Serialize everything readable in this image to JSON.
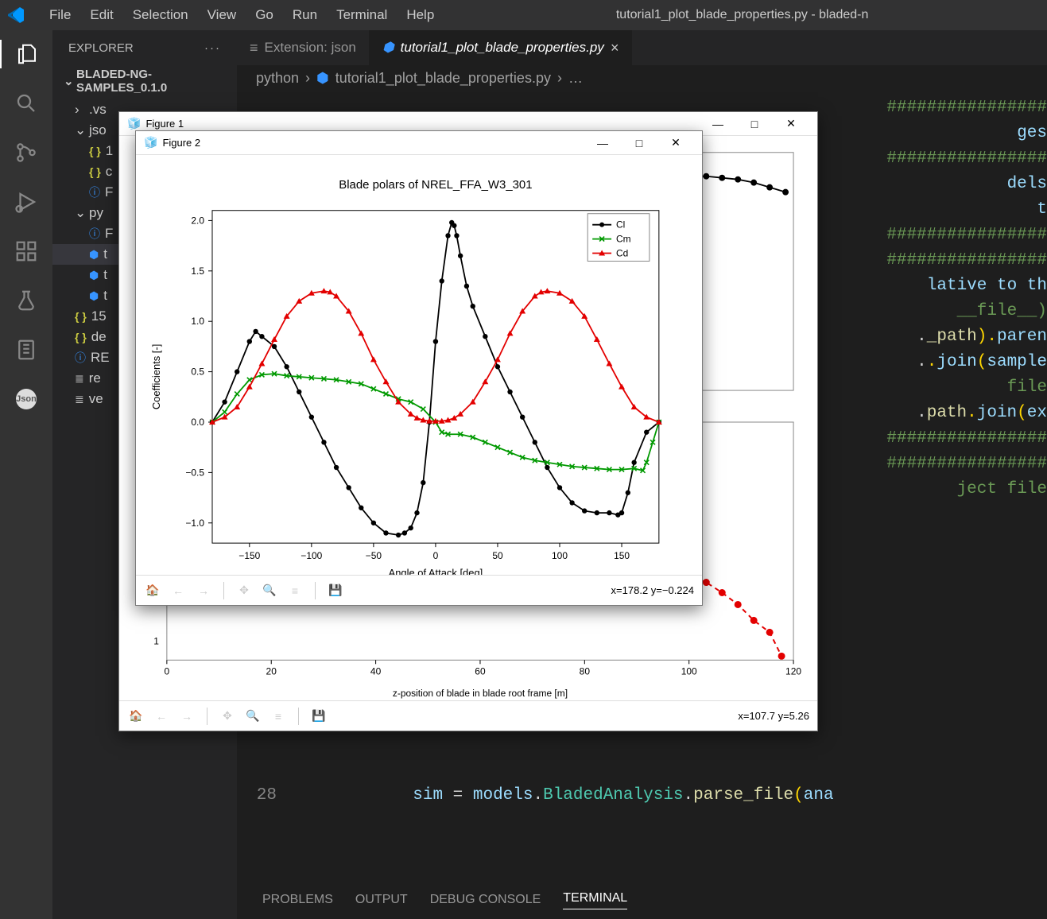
{
  "titlebar": {
    "menus": [
      "File",
      "Edit",
      "Selection",
      "View",
      "Go",
      "Run",
      "Terminal",
      "Help"
    ],
    "title": "tutorial1_plot_blade_properties.py - bladed-n"
  },
  "sidebar": {
    "header": "EXPLORER",
    "workspace": "BLADED-NG-SAMPLES_0.1.0",
    "tree": [
      {
        "label": ".vs",
        "kind": "folder",
        "expanded": false,
        "indent": 1
      },
      {
        "label": "jso",
        "kind": "folder",
        "expanded": true,
        "indent": 1
      },
      {
        "label": "1",
        "kind": "json",
        "indent": 2
      },
      {
        "label": "c",
        "kind": "json",
        "indent": 2
      },
      {
        "label": "F",
        "kind": "info",
        "indent": 2
      },
      {
        "label": "py",
        "kind": "folder",
        "expanded": true,
        "indent": 1
      },
      {
        "label": "F",
        "kind": "info",
        "indent": 2
      },
      {
        "label": "t",
        "kind": "py",
        "indent": 2,
        "selected": true
      },
      {
        "label": "t",
        "kind": "py",
        "indent": 2
      },
      {
        "label": "t",
        "kind": "py",
        "indent": 2
      },
      {
        "label": "15",
        "kind": "json",
        "indent": 1
      },
      {
        "label": "de",
        "kind": "json",
        "indent": 1
      },
      {
        "label": "RE",
        "kind": "info",
        "indent": 1
      },
      {
        "label": "re",
        "kind": "list",
        "indent": 1
      },
      {
        "label": "ve",
        "kind": "list",
        "indent": 1
      }
    ]
  },
  "tabs": {
    "items": [
      {
        "label": "Extension: json",
        "active": false,
        "icon": "ext"
      },
      {
        "label": "tutorial1_plot_blade_properties.py",
        "active": true,
        "icon": "py"
      }
    ]
  },
  "breadcrumb": {
    "parts": [
      "python",
      "tutorial1_plot_blade_properties.py",
      "…"
    ]
  },
  "code": {
    "visible_fragments": [
      "################",
      "ges",
      "################",
      "dels",
      "t",
      "################",
      "################",
      "lative to th",
      "__file__)",
      "_path).paren",
      ".join(sample",
      " file",
      "path.join(ex",
      "################",
      "################",
      "ject file"
    ],
    "line28": {
      "num": "28",
      "text": "sim = models.BladedAnalysis.parse_file(ana"
    }
  },
  "panel": {
    "tabs": [
      "PROBLEMS",
      "OUTPUT",
      "DEBUG CONSOLE",
      "TERMINAL"
    ],
    "active": "TERMINAL"
  },
  "figure1": {
    "title": "Figure 1",
    "xlabel": "z-position of blade in blade root frame [m]",
    "xticks": [
      0,
      20,
      40,
      60,
      80,
      100,
      120
    ],
    "ytick_visible": "1",
    "coords": "x=107.7 y=5.26"
  },
  "figure2": {
    "title": "Figure 2",
    "coords": "x=178.2 y=−0.224"
  },
  "chart_data": {
    "type": "line",
    "title": "Blade polars of NREL_FFA_W3_301",
    "xlabel": "Angle of Attack [deg]",
    "ylabel": "Coefficients [-]",
    "xlim": [
      -180,
      180
    ],
    "ylim": [
      -1.2,
      2.1
    ],
    "xticks": [
      -150,
      -100,
      -50,
      0,
      50,
      100,
      150
    ],
    "yticks": [
      -1.0,
      -0.5,
      0.0,
      0.5,
      1.0,
      1.5,
      2.0
    ],
    "legend": [
      "Cl",
      "Cm",
      "Cd"
    ],
    "series": [
      {
        "name": "Cl",
        "color": "#000000",
        "marker": "o",
        "x": [
          -180,
          -170,
          -160,
          -150,
          -145,
          -140,
          -130,
          -120,
          -110,
          -100,
          -90,
          -80,
          -70,
          -60,
          -50,
          -40,
          -30,
          -25,
          -20,
          -15,
          -10,
          -5,
          0,
          5,
          10,
          13,
          15,
          17,
          20,
          25,
          30,
          40,
          50,
          60,
          70,
          80,
          90,
          100,
          110,
          120,
          130,
          140,
          147,
          150,
          155,
          160,
          170,
          180
        ],
        "y": [
          0.0,
          0.2,
          0.5,
          0.8,
          0.9,
          0.85,
          0.75,
          0.55,
          0.3,
          0.05,
          -0.2,
          -0.45,
          -0.65,
          -0.85,
          -1.0,
          -1.1,
          -1.12,
          -1.1,
          -1.05,
          -0.9,
          -0.6,
          0.0,
          0.8,
          1.4,
          1.85,
          1.98,
          1.95,
          1.85,
          1.65,
          1.35,
          1.15,
          0.85,
          0.55,
          0.3,
          0.05,
          -0.2,
          -0.45,
          -0.65,
          -0.8,
          -0.88,
          -0.9,
          -0.9,
          -0.92,
          -0.9,
          -0.7,
          -0.4,
          -0.1,
          0.0
        ]
      },
      {
        "name": "Cm",
        "color": "#009900",
        "marker": "x",
        "x": [
          -180,
          -170,
          -160,
          -150,
          -140,
          -130,
          -120,
          -110,
          -100,
          -90,
          -80,
          -70,
          -60,
          -50,
          -40,
          -30,
          -20,
          -10,
          0,
          5,
          10,
          20,
          30,
          40,
          50,
          60,
          70,
          80,
          90,
          100,
          110,
          120,
          130,
          140,
          150,
          160,
          167,
          170,
          175,
          180
        ],
        "y": [
          0.0,
          0.1,
          0.28,
          0.42,
          0.47,
          0.48,
          0.46,
          0.45,
          0.44,
          0.43,
          0.42,
          0.4,
          0.38,
          0.33,
          0.28,
          0.23,
          0.2,
          0.13,
          0.0,
          -0.1,
          -0.12,
          -0.12,
          -0.15,
          -0.2,
          -0.25,
          -0.3,
          -0.35,
          -0.38,
          -0.4,
          -0.42,
          -0.44,
          -0.45,
          -0.46,
          -0.47,
          -0.47,
          -0.46,
          -0.48,
          -0.4,
          -0.2,
          0.0
        ]
      },
      {
        "name": "Cd",
        "color": "#e30000",
        "marker": "^",
        "x": [
          -180,
          -170,
          -160,
          -150,
          -140,
          -130,
          -120,
          -110,
          -100,
          -90,
          -85,
          -80,
          -70,
          -60,
          -50,
          -40,
          -30,
          -20,
          -15,
          -10,
          -5,
          0,
          5,
          10,
          15,
          20,
          30,
          40,
          50,
          60,
          70,
          80,
          85,
          90,
          100,
          110,
          120,
          130,
          140,
          150,
          160,
          170,
          180
        ],
        "y": [
          0.0,
          0.05,
          0.15,
          0.35,
          0.58,
          0.82,
          1.05,
          1.2,
          1.28,
          1.3,
          1.29,
          1.25,
          1.1,
          0.88,
          0.62,
          0.4,
          0.2,
          0.08,
          0.04,
          0.02,
          0.01,
          0.01,
          0.01,
          0.02,
          0.04,
          0.08,
          0.2,
          0.4,
          0.62,
          0.88,
          1.1,
          1.25,
          1.29,
          1.3,
          1.28,
          1.2,
          1.05,
          0.82,
          0.58,
          0.35,
          0.15,
          0.05,
          0.0
        ]
      }
    ]
  }
}
